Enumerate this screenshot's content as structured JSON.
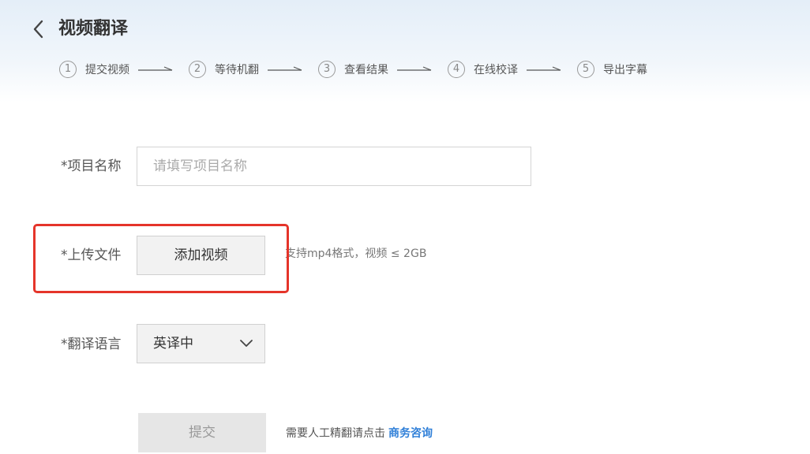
{
  "header": {
    "back_icon": "chevron-left-icon",
    "title": "视频翻译"
  },
  "steps": [
    {
      "num": "1",
      "label": "提交视频"
    },
    {
      "num": "2",
      "label": "等待机翻"
    },
    {
      "num": "3",
      "label": "查看结果"
    },
    {
      "num": "4",
      "label": "在线校译"
    },
    {
      "num": "5",
      "label": "导出字幕"
    }
  ],
  "form": {
    "project_name": {
      "label": "*项目名称",
      "value": "",
      "placeholder": "请填写项目名称"
    },
    "upload": {
      "label": "*上传文件",
      "button_label": "添加视频",
      "hint": "支持mp4格式，视频 ≤ 2GB"
    },
    "language": {
      "label": "*翻译语言",
      "selected": "英译中",
      "icon": "chevron-down-icon"
    },
    "submit": {
      "label": "提交"
    },
    "consult": {
      "text": "需要人工精翻请点击",
      "link": "商务咨询"
    }
  },
  "colors": {
    "highlight": "#e5342a",
    "link": "#2f7fd8",
    "header_bg": "#e4eef8"
  }
}
